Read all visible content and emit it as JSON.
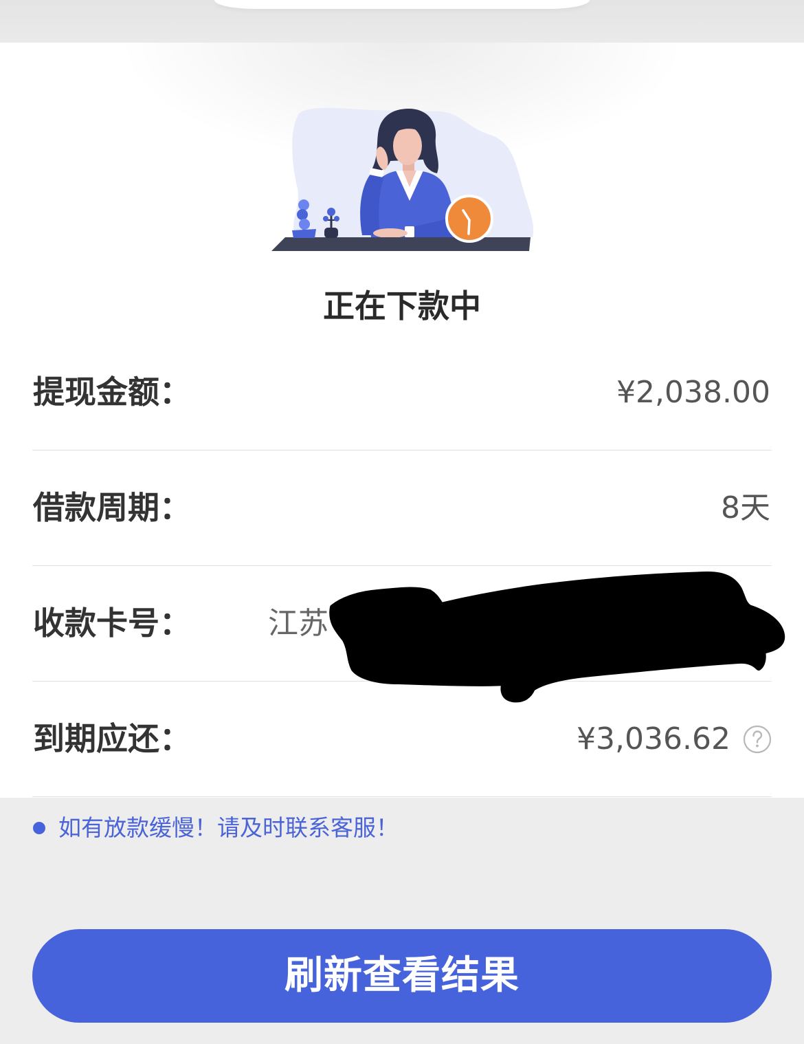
{
  "header": {
    "title": "正在下款中"
  },
  "details": {
    "rows": [
      {
        "label": "提现金额：",
        "value": "¥2,038.00"
      },
      {
        "label": "借款周期：",
        "value": "8天"
      },
      {
        "label": "收款卡号：",
        "value": "江苏"
      },
      {
        "label": "到期应还：",
        "value": "¥3,036.62"
      }
    ],
    "help_icon": "question-circle-icon"
  },
  "notice": {
    "bullet_icon": "dot-icon",
    "text": "如有放款缓慢！请及时联系客服！"
  },
  "action": {
    "refresh_label": "刷新查看结果"
  },
  "colors": {
    "accent": "#4763db",
    "notice_text": "#4a64d8",
    "label_text": "#333333",
    "value_text": "#555555",
    "page_background": "#ededed",
    "card_background": "#ffffff",
    "clock_orange": "#f08a3b"
  }
}
